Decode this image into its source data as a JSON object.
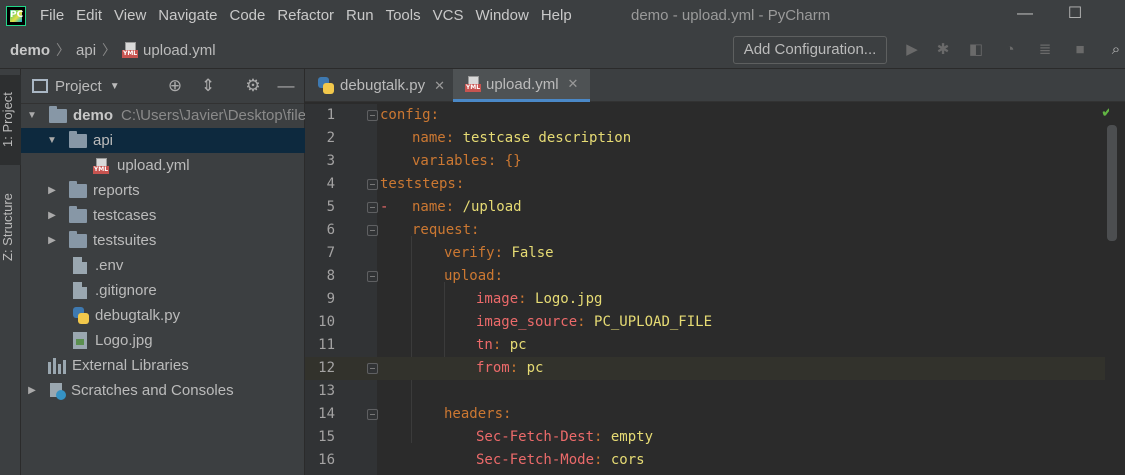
{
  "menubar": {
    "items": [
      {
        "label": "File",
        "u": "F"
      },
      {
        "label": "Edit",
        "u": "E"
      },
      {
        "label": "View",
        "u": "V"
      },
      {
        "label": "Navigate",
        "u": "N"
      },
      {
        "label": "Code",
        "u": "C"
      },
      {
        "label": "Refactor",
        "u": "R"
      },
      {
        "label": "Run",
        "u": "u"
      },
      {
        "label": "Tools",
        "u": "T"
      },
      {
        "label": "VCS",
        "u": "S"
      },
      {
        "label": "Window",
        "u": "W"
      },
      {
        "label": "Help",
        "u": "H"
      }
    ],
    "window_title": "demo - upload.yml - PyCharm",
    "minimize": "—",
    "maximize": "☐"
  },
  "navbar": {
    "crumbs": [
      "demo",
      "api",
      "upload.yml"
    ],
    "add_config": "Add Configuration..."
  },
  "toolstrip": {
    "project_tab": "1: Project",
    "structure_tab": "Z: Structure"
  },
  "project": {
    "title": "Project",
    "tree": [
      {
        "label": "demo",
        "path": "C:\\Users\\Javier\\Desktop\\file"
      },
      {
        "label": "api"
      },
      {
        "label": "upload.yml"
      },
      {
        "label": "reports"
      },
      {
        "label": "testcases"
      },
      {
        "label": "testsuites"
      },
      {
        "label": ".env"
      },
      {
        "label": ".gitignore"
      },
      {
        "label": "debugtalk.py"
      },
      {
        "label": "Logo.jpg"
      },
      {
        "label": "External Libraries"
      },
      {
        "label": "Scratches and Consoles"
      }
    ]
  },
  "editor": {
    "tabs": [
      {
        "label": "debugtalk.py"
      },
      {
        "label": "upload.yml"
      }
    ],
    "current_line": 12,
    "lines": [
      {
        "n": "1",
        "key": "config",
        "val": ""
      },
      {
        "n": "2",
        "key": "name",
        "val": "testcase description"
      },
      {
        "n": "3",
        "key": "variables",
        "val": "{}"
      },
      {
        "n": "4",
        "key": "teststeps",
        "val": ""
      },
      {
        "n": "5",
        "key": "name",
        "val": "/upload"
      },
      {
        "n": "6",
        "key": "request",
        "val": ""
      },
      {
        "n": "7",
        "key": "verify",
        "val": "False"
      },
      {
        "n": "8",
        "key": "upload",
        "val": ""
      },
      {
        "n": "9",
        "key": "image",
        "val": "Logo.jpg"
      },
      {
        "n": "10",
        "key": "image_source",
        "val": "PC_UPLOAD_FILE"
      },
      {
        "n": "11",
        "key": "tn",
        "val": "pc"
      },
      {
        "n": "12",
        "key": "from",
        "val": "pc"
      },
      {
        "n": "13",
        "key": "",
        "val": ""
      },
      {
        "n": "14",
        "key": "headers",
        "val": ""
      },
      {
        "n": "15",
        "key": "Sec-Fetch-Dest",
        "val": "empty"
      },
      {
        "n": "16",
        "key": "Sec-Fetch-Mode",
        "val": "cors"
      }
    ]
  }
}
